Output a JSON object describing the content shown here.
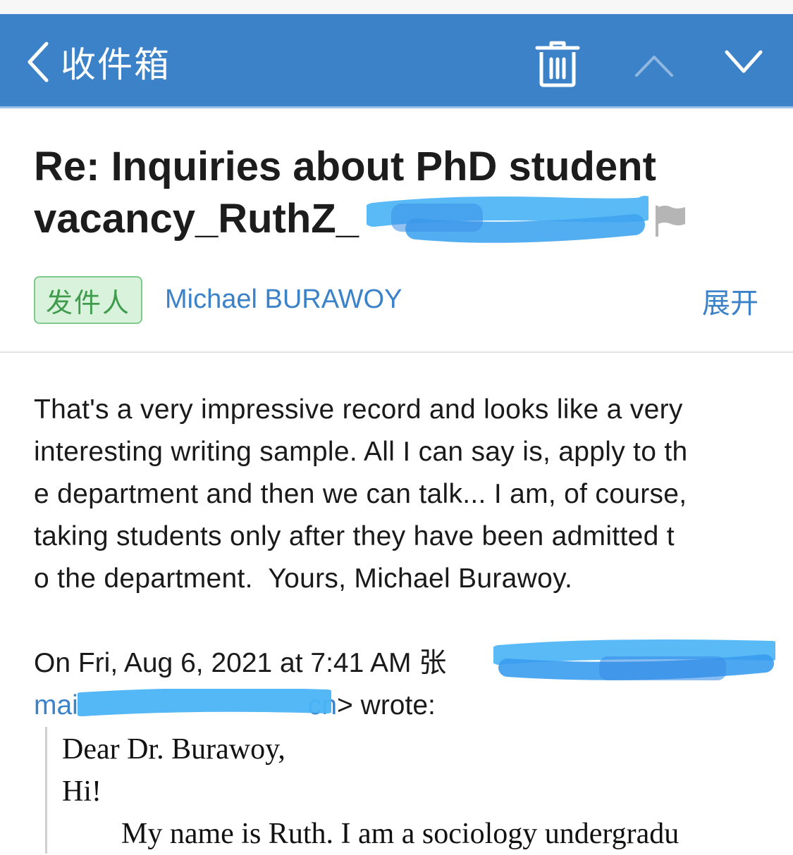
{
  "nav": {
    "back_label": "收件箱",
    "accent": "#3b82c8"
  },
  "icons": [
    "back-chevron-icon",
    "trash-icon",
    "chevron-up-icon",
    "chevron-down-icon",
    "flag-icon"
  ],
  "email": {
    "subject_line1": "Re: Inquiries about PhD student",
    "subject_line2": "vacancy_RuthZ_",
    "sender_tag": "发件人",
    "sender_name": "Michael BURAWOY",
    "expand_label": "展开",
    "body_lines": [
      "That's a very impressive record and looks like a very",
      "interesting writing sample. All I can say is, apply to th",
      "e department and then we can talk... I am, of course,",
      "taking students only after they have been admitted t",
      "o the department.  Yours, Michael Burawoy."
    ],
    "quote_header_line1": "On Fri, Aug 6, 2021 at 7:41 AM 张",
    "quote_link_start": "mai",
    "quote_link_end": "cn",
    "quote_header_tail": "> wrote:",
    "quoted_lines": [
      "Dear Dr. Burawoy,",
      "Hi!",
      "My name is Ruth. I am a sociology undergradu"
    ]
  }
}
